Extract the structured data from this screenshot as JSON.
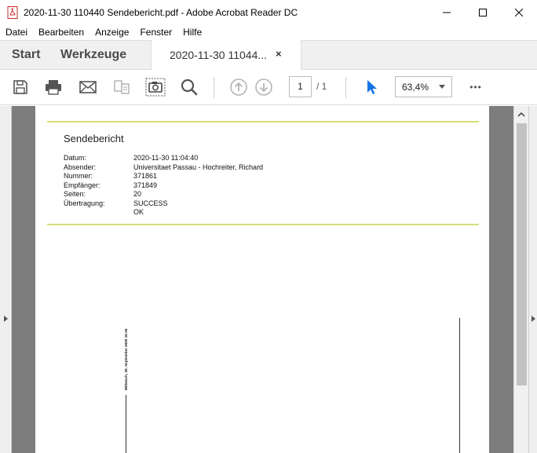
{
  "window": {
    "title": "2020-11-30 110440 Sendebericht.pdf - Adobe Acrobat Reader DC",
    "minimize_glyph": "—",
    "maximize_glyph": "☐",
    "close_glyph": "✕",
    "app_icon": "pdf-icon"
  },
  "menu": {
    "items": [
      "Datei",
      "Bearbeiten",
      "Anzeige",
      "Fenster",
      "Hilfe"
    ]
  },
  "tabs": {
    "start": "Start",
    "tools": "Werkzeuge",
    "document": "2020-11-30 11044...",
    "close_glyph": "×"
  },
  "toolbar": {
    "icons": [
      "save-icon",
      "print-icon",
      "email-icon",
      "compare-icon",
      "snapshot-icon",
      "search-icon",
      "page-up-icon",
      "page-down-icon",
      "select-cursor-icon",
      "more-icon"
    ],
    "current_page": "1",
    "page_total": "/ 1",
    "zoom": "63,4%",
    "more_glyph": "•••"
  },
  "document": {
    "title": "Sendebericht",
    "rows": [
      {
        "key": "Datum:",
        "value": "2020-11-30 11:04:40"
      },
      {
        "key": "Absender:",
        "value": "Universitaet Passau - Hochreiter, Richard"
      },
      {
        "key": "Nummer:",
        "value": "371861"
      },
      {
        "key": "Empfänger:",
        "value": "371849"
      },
      {
        "key": "Seiten:",
        "value": "20"
      },
      {
        "key": "Übertragung:",
        "value": "SUCCESS"
      },
      {
        "key": "",
        "value": "OK"
      }
    ],
    "rotated_text": "Mittwoch, 30. September 2020 16:36"
  },
  "colors": {
    "accent_blue": "#1473e6",
    "rule_line": "#d6dd7a",
    "pdf_red": "#d32f2f"
  }
}
